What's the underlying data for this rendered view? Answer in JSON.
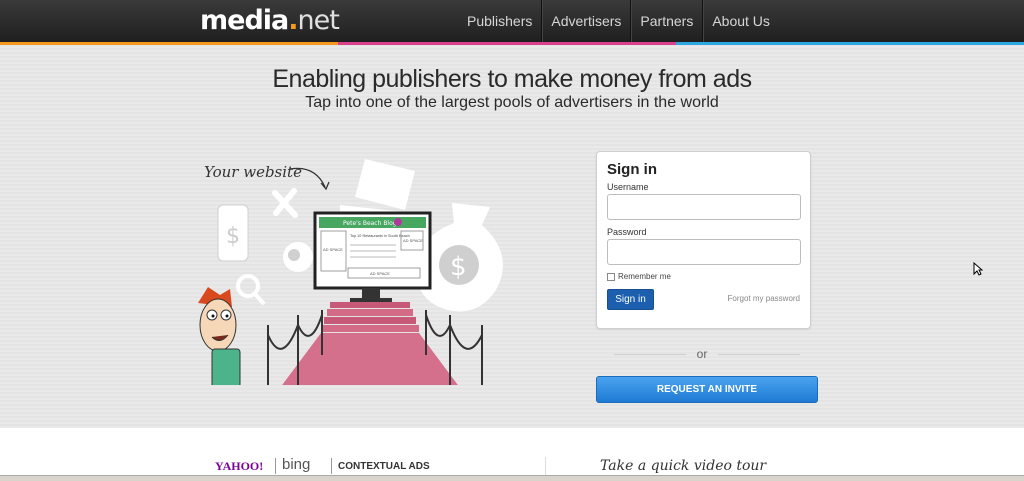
{
  "header": {
    "logo": {
      "media": "media",
      "dot": ".",
      "net": "net"
    },
    "nav": [
      "Publishers",
      "Advertisers",
      "Partners",
      "About Us"
    ]
  },
  "hero": {
    "headline": "Enabling publishers to make money from ads",
    "subline": "Tap into one of the largest pools of advertisers in the world",
    "illustration": {
      "your_website": "Your website",
      "blog_title": "Pete's Beach Blog",
      "blog_text": "Top 10 Restaurants in South Beach",
      "ad_space": "AD SPACE"
    }
  },
  "signin": {
    "title": "Sign in",
    "username_label": "Username",
    "username_value": "",
    "password_label": "Password",
    "password_value": "",
    "remember": "Remember me",
    "button": "Sign in",
    "forgot": "Forgot my password"
  },
  "or": "or",
  "invite_button": "REQUEST AN INVITE",
  "partners": {
    "yahoo": "YAHOO!",
    "bing": "bing",
    "contextual": "CONTEXTUAL ADS",
    "video_tour": "Take a quick video tour"
  },
  "colors": {
    "accent": "#f39a1e",
    "pink": "#d9418c",
    "blue": "#2ea8e0",
    "carpet": "#d76e8b",
    "signin_btn": "#1b5fae"
  }
}
